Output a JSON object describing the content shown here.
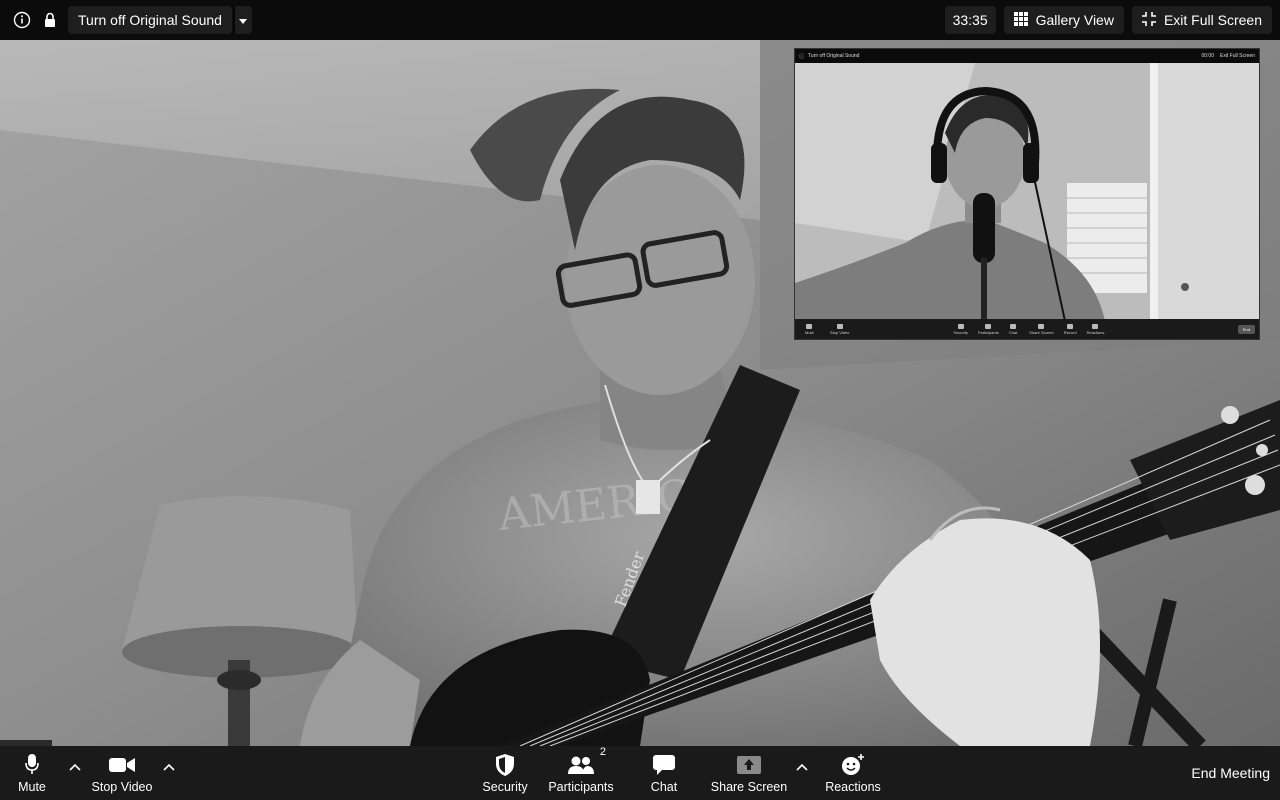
{
  "top_bar": {
    "original_sound_label": "Turn off Original Sound",
    "timer": "33:35",
    "gallery_view_label": "Gallery View",
    "exit_full_screen_label": "Exit Full Screen"
  },
  "self_view": {
    "original_sound_label": "Turn off Original Sound",
    "timer": "00:00",
    "exit_full_screen_label": "Exit Full Screen",
    "toolbar": {
      "mute": "Mute",
      "stop_video": "Stop Video",
      "security": "Security",
      "participants": "Participants",
      "chat": "Chat",
      "share_screen": "Share Screen",
      "record": "Record",
      "reactions": "Reactions",
      "end": "End"
    }
  },
  "toolbar": {
    "mute_label": "Mute",
    "stop_video_label": "Stop Video",
    "security_label": "Security",
    "participants_label": "Participants",
    "participants_count": "2",
    "chat_label": "Chat",
    "share_screen_label": "Share Screen",
    "reactions_label": "Reactions",
    "end_meeting_label": "End Meeting"
  },
  "icons": {
    "info": "info-icon",
    "lock": "lock-icon",
    "dropdown": "chevron-down-icon",
    "gallery": "grid-icon",
    "exit_full_screen": "exit-fullscreen-icon",
    "mic": "microphone-icon",
    "camera": "video-camera-icon",
    "shield": "shield-icon",
    "participants": "people-icon",
    "chat": "chat-bubble-icon",
    "share": "share-screen-icon",
    "reactions": "smiley-plus-icon"
  },
  "colors": {
    "top_bar_bg": "#0b0b0b",
    "toolbar_bg": "#1a1a1a",
    "text": "#ffffff"
  }
}
